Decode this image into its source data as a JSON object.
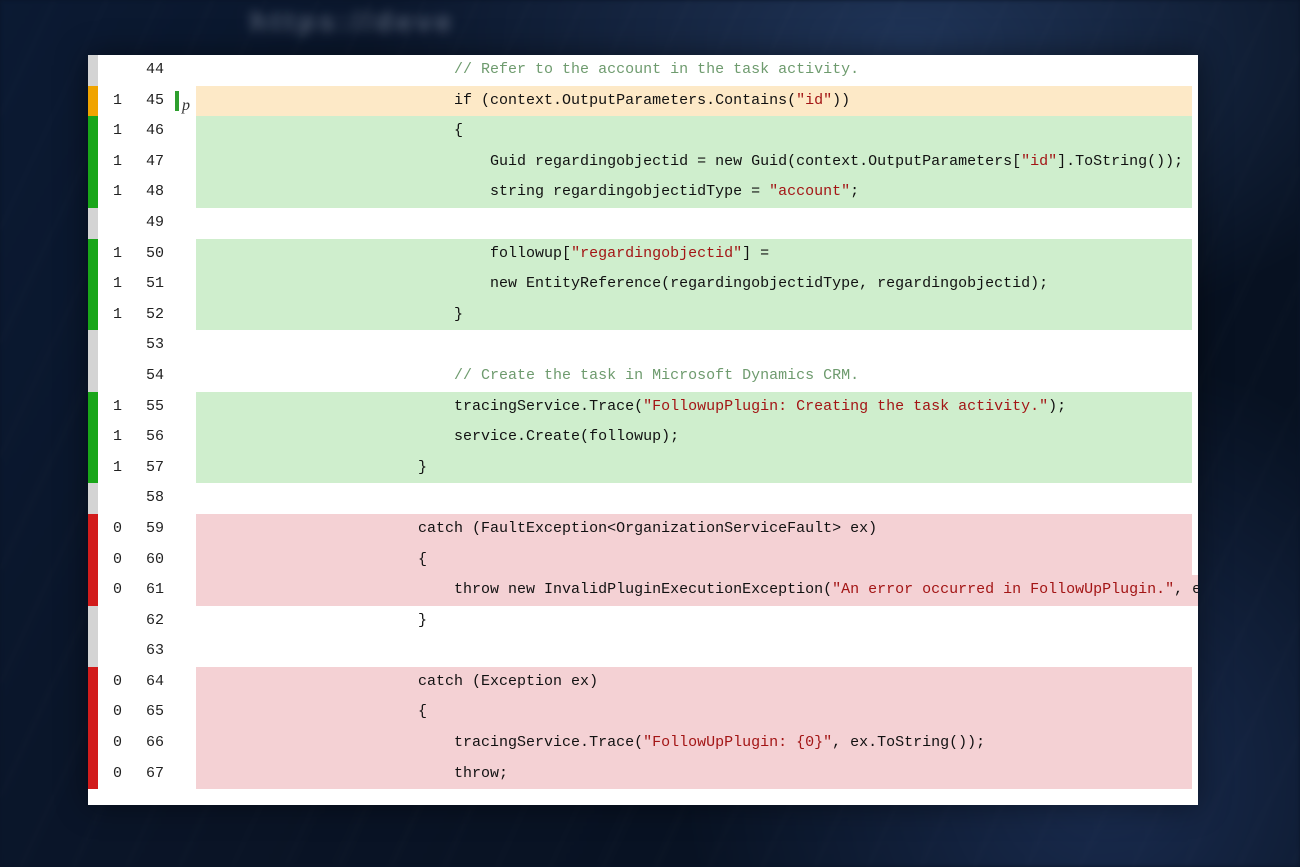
{
  "coverage_colors": {
    "covered": "#cfeecd",
    "uncovered": "#f4d1d4",
    "partial": "#fde9c7"
  },
  "lines": [
    {
      "line": 44,
      "hits": "",
      "mark": "none",
      "bg": "none",
      "icon": "",
      "code": "                            // Refer to the account in the task activity."
    },
    {
      "line": 45,
      "hits": "1",
      "mark": "orange",
      "bg": "orange",
      "icon": "bp",
      "code": "                            if (context.OutputParameters.Contains(\"id\"))"
    },
    {
      "line": 46,
      "hits": "1",
      "mark": "green",
      "bg": "green",
      "icon": "",
      "code": "                            {"
    },
    {
      "line": 47,
      "hits": "1",
      "mark": "green",
      "bg": "green",
      "icon": "",
      "code": "                                Guid regardingobjectid = new Guid(context.OutputParameters[\"id\"].ToString());"
    },
    {
      "line": 48,
      "hits": "1",
      "mark": "green",
      "bg": "green",
      "icon": "",
      "code": "                                string regardingobjectidType = \"account\";"
    },
    {
      "line": 49,
      "hits": "",
      "mark": "none",
      "bg": "none",
      "icon": "",
      "code": ""
    },
    {
      "line": 50,
      "hits": "1",
      "mark": "green",
      "bg": "green",
      "icon": "",
      "code": "                                followup[\"regardingobjectid\"] ="
    },
    {
      "line": 51,
      "hits": "1",
      "mark": "green",
      "bg": "green",
      "icon": "",
      "code": "                                new EntityReference(regardingobjectidType, regardingobjectid);"
    },
    {
      "line": 52,
      "hits": "1",
      "mark": "green",
      "bg": "green",
      "icon": "",
      "code": "                            }"
    },
    {
      "line": 53,
      "hits": "",
      "mark": "none",
      "bg": "none",
      "icon": "",
      "code": ""
    },
    {
      "line": 54,
      "hits": "",
      "mark": "none",
      "bg": "none",
      "icon": "",
      "code": "                            // Create the task in Microsoft Dynamics CRM."
    },
    {
      "line": 55,
      "hits": "1",
      "mark": "green",
      "bg": "green",
      "icon": "",
      "code": "                            tracingService.Trace(\"FollowupPlugin: Creating the task activity.\");"
    },
    {
      "line": 56,
      "hits": "1",
      "mark": "green",
      "bg": "green",
      "icon": "",
      "code": "                            service.Create(followup);"
    },
    {
      "line": 57,
      "hits": "1",
      "mark": "green",
      "bg": "green",
      "icon": "",
      "code": "                        }"
    },
    {
      "line": 58,
      "hits": "",
      "mark": "none",
      "bg": "none",
      "icon": "",
      "code": ""
    },
    {
      "line": 59,
      "hits": "0",
      "mark": "red",
      "bg": "red",
      "icon": "",
      "code": "                        catch (FaultException<OrganizationServiceFault> ex)"
    },
    {
      "line": 60,
      "hits": "0",
      "mark": "red",
      "bg": "red",
      "icon": "",
      "code": "                        {"
    },
    {
      "line": 61,
      "hits": "0",
      "mark": "red",
      "bg": "red",
      "icon": "",
      "code": "                            throw new InvalidPluginExecutionException(\"An error occurred in FollowUpPlugin.\", ex);"
    },
    {
      "line": 62,
      "hits": "",
      "mark": "none",
      "bg": "none",
      "icon": "",
      "code": "                        }"
    },
    {
      "line": 63,
      "hits": "",
      "mark": "none",
      "bg": "none",
      "icon": "",
      "code": ""
    },
    {
      "line": 64,
      "hits": "0",
      "mark": "red",
      "bg": "red",
      "icon": "",
      "code": "                        catch (Exception ex)"
    },
    {
      "line": 65,
      "hits": "0",
      "mark": "red",
      "bg": "red",
      "icon": "",
      "code": "                        {"
    },
    {
      "line": 66,
      "hits": "0",
      "mark": "red",
      "bg": "red",
      "icon": "",
      "code": "                            tracingService.Trace(\"FollowUpPlugin: {0}\", ex.ToString());"
    },
    {
      "line": 67,
      "hits": "0",
      "mark": "red",
      "bg": "red",
      "icon": "",
      "code": "                            throw;"
    }
  ]
}
